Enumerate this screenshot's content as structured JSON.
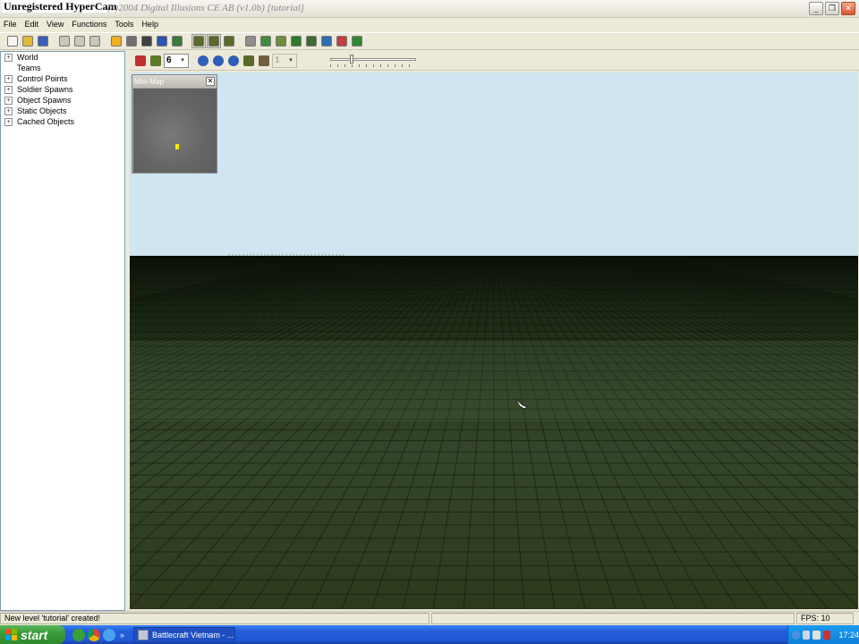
{
  "window": {
    "title_watermark": "Unregistered HyperCam",
    "title_suffix": "(c)2004 Digital Illusions CE AB (v1.0b) [tutorial]",
    "min_glyph": "_",
    "max_glyph": "❐",
    "close_glyph": "✕"
  },
  "menu": [
    "File",
    "Edit",
    "View",
    "Functions",
    "Tools",
    "Help"
  ],
  "toolbar1": {
    "icons": [
      {
        "name": "new-icon",
        "color": "#f4f4f4"
      },
      {
        "name": "open-icon",
        "color": "#e3b93a"
      },
      {
        "name": "save-icon",
        "color": "#3a5fb8"
      },
      {
        "name": "cut-icon",
        "color": "#c8c6bd"
      },
      {
        "name": "copy-icon",
        "color": "#c8c6bd"
      },
      {
        "name": "paste-icon",
        "color": "#c8c6bd"
      },
      {
        "name": "light-icon",
        "color": "#f0b020"
      },
      {
        "name": "frame-icon",
        "color": "#6f6f6f"
      },
      {
        "name": "binoculars-icon",
        "color": "#404040"
      },
      {
        "name": "camera-icon",
        "color": "#2c55b5"
      },
      {
        "name": "grid-icon",
        "color": "#3a7a3a"
      },
      {
        "name": "tank-icon",
        "color": "#5a6a2a"
      },
      {
        "name": "tank-select-icon",
        "color": "#5a6a2a"
      },
      {
        "name": "tank-place-icon",
        "color": "#5a6a2a"
      },
      {
        "name": "mesh-icon",
        "color": "#8f8f8f"
      },
      {
        "name": "terrain-icon",
        "color": "#3e8d3e"
      },
      {
        "name": "grid-toggle-icon",
        "color": "#6f8f3a"
      },
      {
        "name": "tree-icon",
        "color": "#2e7a2e"
      },
      {
        "name": "map-icon",
        "color": "#3f6b2f"
      },
      {
        "name": "globe-icon",
        "color": "#2f6fb0"
      },
      {
        "name": "target-icon",
        "color": "#c04040"
      },
      {
        "name": "shield-icon",
        "color": "#2e8a2e"
      }
    ]
  },
  "tree": [
    {
      "label": "World",
      "expandable": true
    },
    {
      "label": "Teams",
      "expandable": false
    },
    {
      "label": "Control Points",
      "expandable": true
    },
    {
      "label": "Soldier Spawns",
      "expandable": true
    },
    {
      "label": "Object Spawns",
      "expandable": true
    },
    {
      "label": "Static Objects",
      "expandable": true
    },
    {
      "label": "Cached Objects",
      "expandable": true
    }
  ],
  "tree_expand_glyph": "+",
  "toolbar2": {
    "brush_size": "6",
    "layer_value": "1",
    "dropdown_glyph": "▾"
  },
  "minimap": {
    "title": "Mini-Map",
    "close_glyph": "✕"
  },
  "status": {
    "message": "New level 'tutorial' created!",
    "fps": "FPS: 10"
  },
  "taskbar": {
    "start_label": "start",
    "task_label": "Battlecraft Vietnam - ...",
    "more_glyph": "»",
    "clock": "17:24"
  }
}
